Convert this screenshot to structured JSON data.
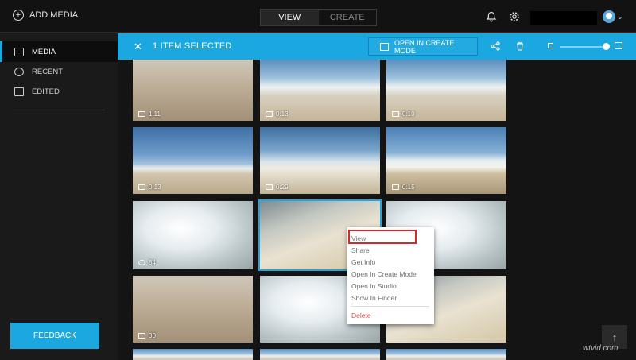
{
  "topbar": {
    "add_media": "ADD MEDIA",
    "add_icon": "plus-circle-icon",
    "modes": [
      {
        "label": "VIEW",
        "active": true
      },
      {
        "label": "CREATE",
        "active": false
      }
    ],
    "icons": [
      "bell-icon",
      "gear-icon",
      "avatar-icon",
      "chevron-down-icon"
    ]
  },
  "sidebar": {
    "items": [
      {
        "label": "MEDIA",
        "icon": "media-icon",
        "active": true
      },
      {
        "label": "RECENT",
        "icon": "recent-icon",
        "active": false
      },
      {
        "label": "EDITED",
        "icon": "edited-icon",
        "active": false
      }
    ],
    "feedback": "FEEDBACK"
  },
  "selection_bar": {
    "close": "✕",
    "count": "1 ITEM SELECTED",
    "open_create": "OPEN IN CREATE MODE",
    "icons": [
      "share-icon",
      "trash-icon",
      "small-thumb-icon",
      "large-thumb-icon"
    ],
    "zoom_level": 0.88
  },
  "thumbnails": [
    {
      "badge": "1:11",
      "badge_icon": "video-icon"
    },
    {
      "badge": "0:13",
      "badge_icon": "video-icon"
    },
    {
      "badge": "0:10",
      "badge_icon": "video-icon"
    },
    {
      "badge": "0:13",
      "badge_icon": "video-icon"
    },
    {
      "badge": "0:29",
      "badge_icon": "video-icon"
    },
    {
      "badge": "0:15",
      "badge_icon": "video-icon"
    },
    {
      "badge": "84",
      "badge_icon": "timelapse-icon"
    },
    {
      "badge": "",
      "badge_icon": ""
    },
    {
      "badge": "",
      "badge_icon": ""
    },
    {
      "badge": "30",
      "badge_icon": "burst-icon"
    },
    {
      "badge": "",
      "badge_icon": ""
    },
    {
      "badge": "",
      "badge_icon": ""
    }
  ],
  "context_menu": {
    "items": [
      "View",
      "Share",
      "Get Info",
      "Open In Create Mode",
      "Open In Studio",
      "Show In Finder"
    ],
    "delete": "Delete"
  },
  "scroll_top": "↑",
  "watermark": "wtvid.com"
}
